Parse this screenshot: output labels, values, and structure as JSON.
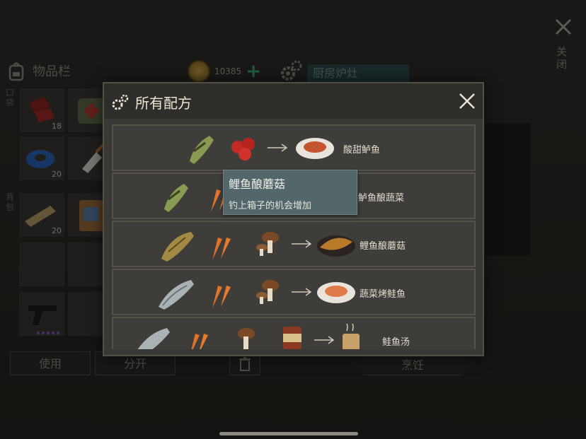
{
  "close_label": "关闭",
  "inventory": {
    "title": "物品栏",
    "pocket_label": "口袋",
    "backpack_label": "背包",
    "counts": [
      "18",
      "20",
      "20"
    ]
  },
  "coins": {
    "amount": "10385"
  },
  "station": {
    "name": "厨房炉灶"
  },
  "buttons": {
    "use": "使用",
    "split": "分开",
    "cook": "烹饪"
  },
  "dialog": {
    "title": "所有配方",
    "recipes": [
      {
        "result": "酸甜鲈鱼",
        "ingredients": [
          "perch-icon",
          "tomato-icon"
        ]
      },
      {
        "result": "鲈鱼酿蔬菜",
        "ingredients": [
          "perch-icon",
          "carrot-icon"
        ]
      },
      {
        "result": "鲤鱼酿蘑菇",
        "ingredients": [
          "carp-icon",
          "carrot-icon",
          "mushroom-icon"
        ]
      },
      {
        "result": "蔬菜烤鲑鱼",
        "ingredients": [
          "salmon-icon",
          "carrot-icon",
          "mushroom-icon"
        ]
      },
      {
        "result": "鲑鱼汤",
        "ingredients": [
          "salmon-icon",
          "carrot-icon",
          "mushroom-icon",
          "canned-food-icon"
        ]
      }
    ]
  },
  "tooltip": {
    "title": "鲤鱼酿蘑菇",
    "description": "钓上箱子的机会增加"
  },
  "colors": {
    "accent_green": "#37a86f",
    "tooltip_bg": "#53666a"
  }
}
